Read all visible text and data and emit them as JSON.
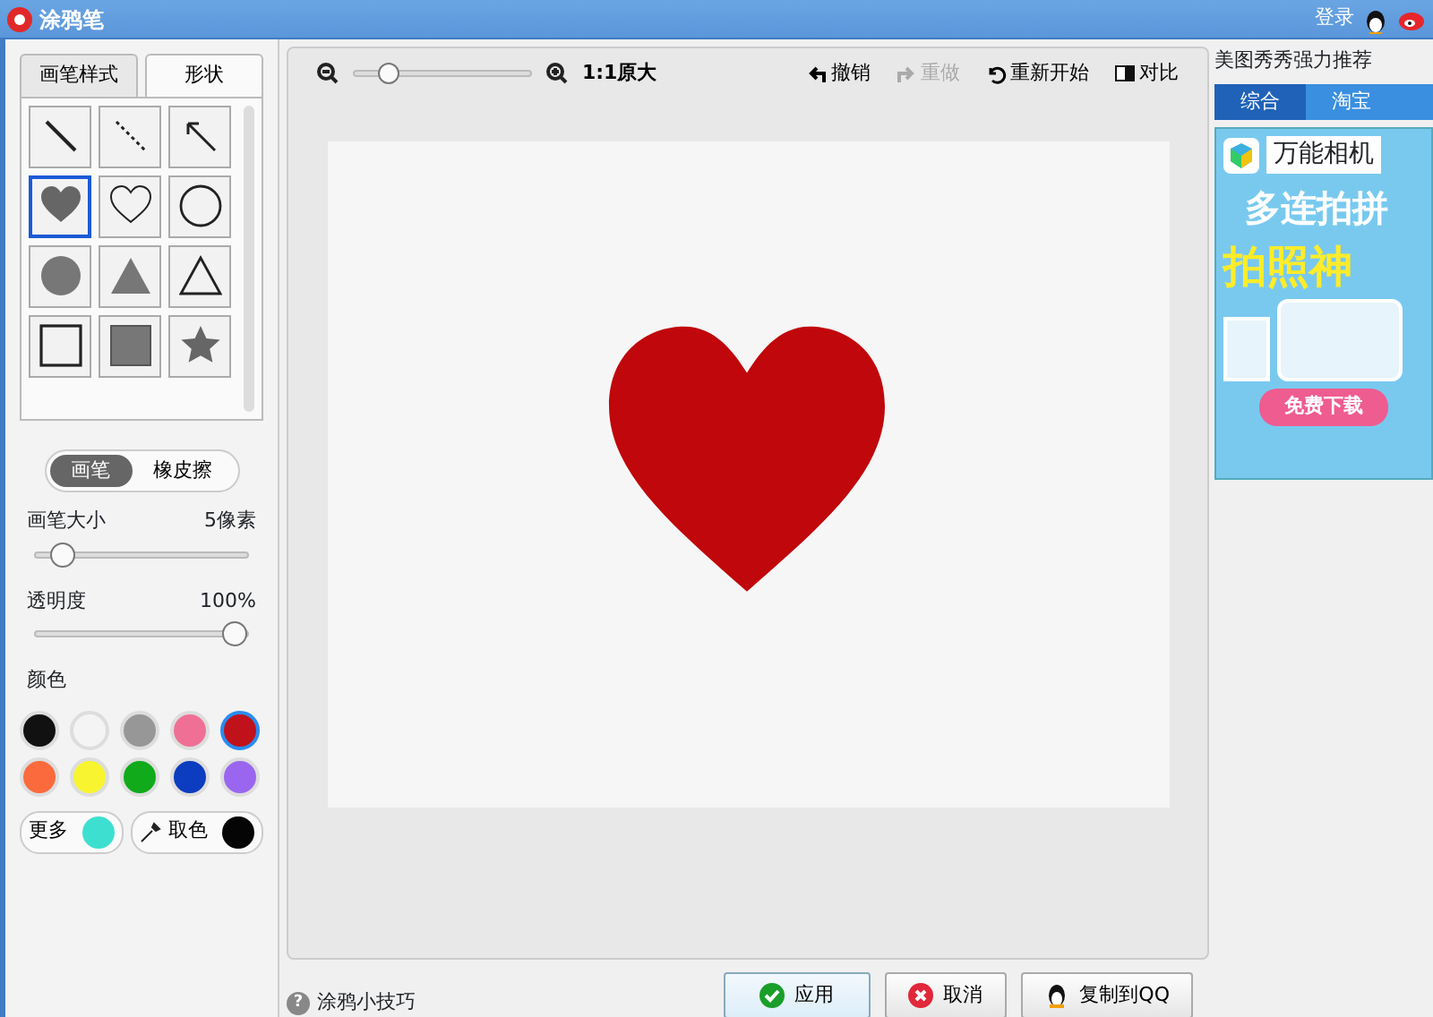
{
  "title_bar": {
    "title": "涂鸦笔",
    "login": "登录"
  },
  "left_tabs": [
    {
      "label": "画笔样式",
      "selected": false
    },
    {
      "label": "形状",
      "selected": true
    }
  ],
  "shapes": [
    {
      "kind": "line",
      "selected": false
    },
    {
      "kind": "dashed",
      "selected": false
    },
    {
      "kind": "arrow",
      "selected": false
    },
    {
      "kind": "heart",
      "selected": true
    },
    {
      "kind": "heart-outline",
      "selected": false
    },
    {
      "kind": "circle-outline",
      "selected": false
    },
    {
      "kind": "circle",
      "selected": false
    },
    {
      "kind": "triangle",
      "selected": false
    },
    {
      "kind": "triangle-outline",
      "selected": false
    },
    {
      "kind": "square-outline",
      "selected": false
    },
    {
      "kind": "square",
      "selected": false
    },
    {
      "kind": "star",
      "selected": false
    }
  ],
  "mode_toggle": [
    {
      "label": "画笔",
      "selected": true
    },
    {
      "label": "橡皮擦",
      "selected": false
    }
  ],
  "brush_size": {
    "label": "画笔大小",
    "reading": "5像素",
    "level": 0.08
  },
  "opacity": {
    "label": "透明度",
    "reading": "100%",
    "level": 1
  },
  "colors_label": "颜色",
  "colors": [
    {
      "color": "#111111",
      "selected": false
    },
    {
      "color": "#f4f4f4",
      "selected": false
    },
    {
      "color": "#979797",
      "selected": false
    },
    {
      "color": "#f07095",
      "selected": false
    },
    {
      "color": "#c0121a",
      "selected": true
    },
    {
      "color": "#fb6a3d",
      "selected": false
    },
    {
      "color": "#f8f530",
      "selected": false
    },
    {
      "color": "#10aa1a",
      "selected": false
    },
    {
      "color": "#0c3cbf",
      "selected": false
    },
    {
      "color": "#9a66f0",
      "selected": false
    }
  ],
  "more": {
    "label": "更多",
    "color": "#3de0d0"
  },
  "picker": {
    "label": "取色",
    "color": "#050505"
  },
  "zoom": {
    "level": 0.2,
    "label": "1:1原大"
  },
  "toolbar": [
    {
      "kind": "undo",
      "label": "撤销",
      "disabled": false
    },
    {
      "kind": "redo",
      "label": "重做",
      "disabled": true
    },
    {
      "kind": "restart",
      "label": "重新开始",
      "disabled": false
    },
    {
      "kind": "compare",
      "label": "对比",
      "disabled": false
    }
  ],
  "canvas": {
    "color": "#c0070b"
  },
  "recommend": {
    "title": "美图秀秀强力推荐",
    "tabs": [
      {
        "label": "综合",
        "selected": true
      },
      {
        "label": "淘宝",
        "selected": false
      }
    ],
    "ad": {
      "brand": "万能相机",
      "headline": "多连拍拼",
      "subline": "拍照神",
      "cta": "免费下载"
    }
  },
  "footer": {
    "tip_icon": "?",
    "tip": "涂鸦小技巧",
    "buttons": [
      {
        "kind": "apply",
        "label": "应用"
      },
      {
        "kind": "cancel",
        "label": "取消"
      },
      {
        "kind": "qq",
        "label": "复制到QQ"
      }
    ]
  }
}
